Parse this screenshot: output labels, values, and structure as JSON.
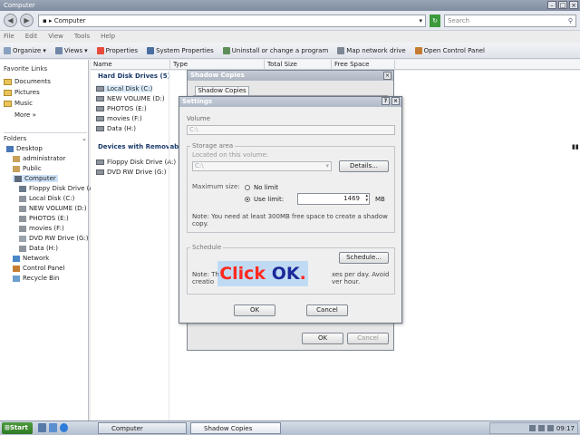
{
  "window": {
    "title": "Computer"
  },
  "address": {
    "breadcrumb": "Computer",
    "arrow": "▸",
    "search_placeholder": "Search"
  },
  "menu": [
    "File",
    "Edit",
    "View",
    "Tools",
    "Help"
  ],
  "toolbar": {
    "organize": "Organize",
    "views": "Views",
    "properties": "Properties",
    "system_properties": "System Properties",
    "uninstall": "Uninstall or change a program",
    "map_drive": "Map network drive",
    "control_panel": "Open Control Panel"
  },
  "favorites": {
    "heading": "Favorite Links",
    "items": [
      "Documents",
      "Pictures",
      "Music"
    ],
    "more": "More »"
  },
  "folders": {
    "heading": "Folders",
    "items": [
      {
        "label": "Desktop",
        "indent": 1,
        "icon": "desktop"
      },
      {
        "label": "administrator",
        "indent": 2,
        "icon": "user"
      },
      {
        "label": "Public",
        "indent": 2,
        "icon": "user"
      },
      {
        "label": "Computer",
        "indent": 2,
        "icon": "computer"
      },
      {
        "label": "Floppy Disk Drive (A:)",
        "indent": 3,
        "icon": "floppy"
      },
      {
        "label": "Local Disk (C:)",
        "indent": 3,
        "icon": "drive"
      },
      {
        "label": "NEW VOLUME (D:)",
        "indent": 3,
        "icon": "drive"
      },
      {
        "label": "PHOTOS (E:)",
        "indent": 3,
        "icon": "drive"
      },
      {
        "label": "movies (F:)",
        "indent": 3,
        "icon": "drive"
      },
      {
        "label": "DVD RW Drive (G:)",
        "indent": 3,
        "icon": "dvd"
      },
      {
        "label": "Data (H:)",
        "indent": 3,
        "icon": "drive"
      },
      {
        "label": "Network",
        "indent": 2,
        "icon": "network"
      },
      {
        "label": "Control Panel",
        "indent": 2,
        "icon": "control"
      },
      {
        "label": "Recycle Bin",
        "indent": 2,
        "icon": "recycle"
      }
    ]
  },
  "columns": [
    "Name",
    "Type",
    "Total Size",
    "Free Space"
  ],
  "hard_disks": {
    "heading": "Hard Disk Drives (5)",
    "items": [
      "Local Disk (C:)",
      "NEW VOLUME (D:)",
      "PHOTOS (E:)",
      "movies (F:)",
      "Data (H:)"
    ]
  },
  "removable": {
    "heading": "Devices with Removable",
    "items": [
      "Floppy Disk Drive (A:)",
      "DVD RW Drive (G:)"
    ]
  },
  "shadow_copies": {
    "title": "Shadow Copies",
    "tab": "Shadow Copies",
    "ok": "OK",
    "cancel": "Cancel"
  },
  "settings": {
    "title": "Settings",
    "volume_label": "Volume",
    "volume_value": "C:\\",
    "storage_area": "Storage area",
    "located_label": "Located on this volume:",
    "located_value": "C:\\",
    "details": "Details...",
    "max_size": "Maximum size:",
    "no_limit": "No limit",
    "use_limit": "Use limit:",
    "limit_value": "1469",
    "unit": "MB",
    "note": "Note: You need at least 300MB free space to create a shadow copy.",
    "schedule_heading": "Schedule",
    "schedule_button": "Schedule...",
    "schedule_note_start": "Note: Th",
    "schedule_note_mid": "xes per day. Avoid",
    "schedule_note_line2_start": "creatio",
    "schedule_note_line2_end": "ver hour.",
    "ok": "OK",
    "cancel": "Cancel"
  },
  "tooltip": {
    "prefix": "Click ",
    "target": "OK",
    "suffix": ".",
    "prefix_color": "#ff2a1f",
    "target_color": "#1a2a9a"
  },
  "taskbar": {
    "start": "Start",
    "tasks": [
      "Computer",
      "Shadow Copies"
    ],
    "clock": "09:17"
  }
}
